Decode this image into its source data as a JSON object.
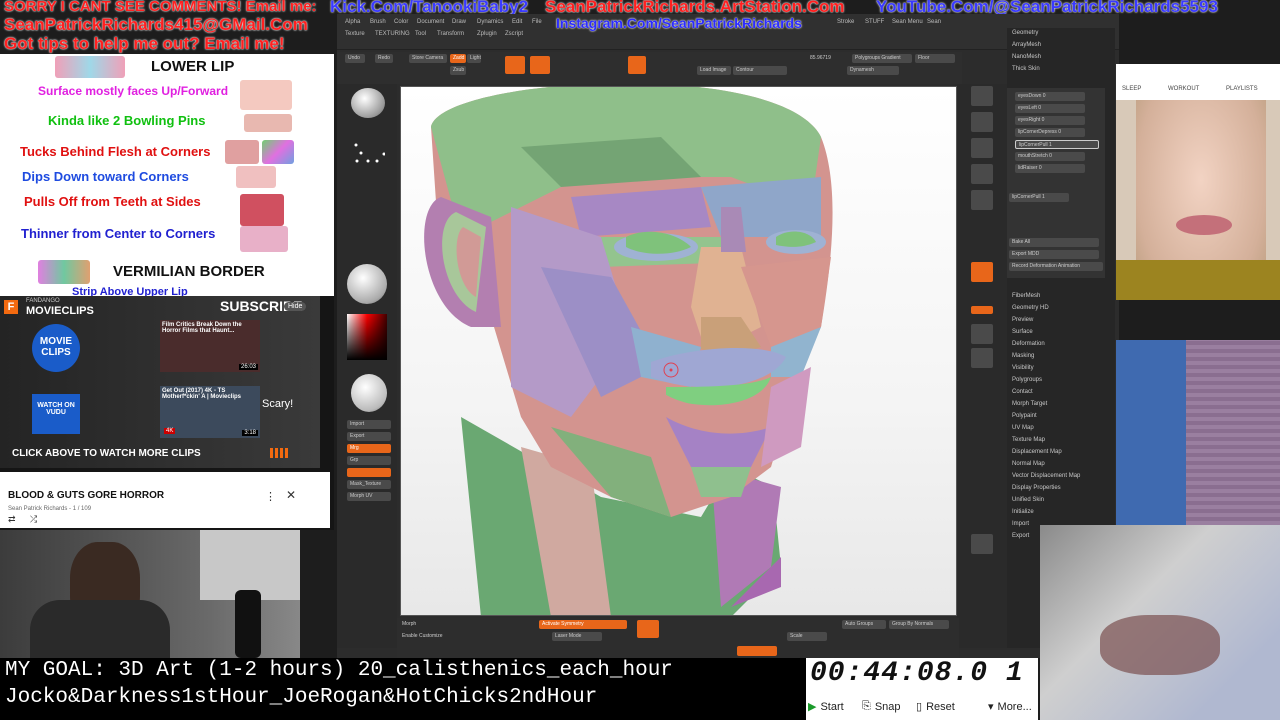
{
  "banner": {
    "line1": "SORRY I CANT SEE COMMENTS! Email me:",
    "line2": "Kick.Com/TanookiBaby2",
    "line3": "SeanPatrickRichards.ArtStation.Com",
    "line4": "YouTube.Com/@SeanPatrickRichards5593",
    "line5": "SeanPatrickRichards415@GMail.Com",
    "line6": "Got tips to help me out? Email me!",
    "line7": "Instagram.Com/SeanPatrickRichards"
  },
  "lip_sheet": {
    "title": "LOWER LIP",
    "rows": [
      {
        "text": "Surface mostly faces Up/Forward",
        "color": "#e020e0"
      },
      {
        "text": "Kinda like 2 Bowling Pins",
        "color": "#10c010"
      },
      {
        "text": "Tucks Behind Flesh at Corners",
        "color": "#e01010"
      },
      {
        "text": "Dips Down toward Corners",
        "color": "#1e4be0"
      },
      {
        "text": "Pulls Off from Teeth at Sides",
        "color": "#e01010"
      },
      {
        "text": "Thinner from Center to Corners",
        "color": "#2020d0"
      }
    ],
    "footer_title": "VERMILIAN BORDER",
    "footer_sub": "Strip Above Upper Lip"
  },
  "youtube": {
    "channel": "MOVIECLIPS",
    "channel_tag": "FANDANGO",
    "subscribe": "SUBSCRIBE",
    "hide": "Hide",
    "logo_text": "MOVIE CLIPS",
    "vudu_text": "WATCH ON VUDU",
    "card1_title": "Film Critics Break Down the Horror Films that Haunt...",
    "card1_time": "26:03",
    "card2_title": "Get Out (2017) 4K - TS Motherf*ckin' A | Movieclips",
    "card2_time": "3:18",
    "card2_tag": "4K",
    "scary": "Scary!",
    "click_above": "CLICK ABOVE TO WATCH MORE CLIPS",
    "playlist_title": "BLOOD & GUTS GORE HORROR",
    "playlist_sub": "Sean Patrick Richards - 1 / 109"
  },
  "zbrush": {
    "menu": [
      "Alpha",
      "Brush",
      "Color",
      "Document",
      "Draw",
      "Dynamics",
      "Edit",
      "File",
      "Layer",
      "Light",
      "Macro",
      "Marker",
      "Material",
      "Movie",
      "Picker",
      "Preferences",
      "Render",
      "Stencil",
      "Stroke",
      "STUFF",
      "Sean Menu",
      "Sean"
    ],
    "menu2": [
      "Texture",
      "TEXTURING",
      "Tool",
      "Transform",
      "Zplugin",
      "Zscript",
      "Help"
    ],
    "tool_buttons": [
      "Undo",
      "Redo",
      "Store Camera",
      "Zadd",
      "Zsub",
      "Lights",
      "Load Image",
      "Save MT",
      "Dynamesh",
      "Activate Symmetry",
      "Polygroups Gradient",
      "Contour",
      "Sculpt",
      "Floor"
    ],
    "numbers": [
      "85.96719",
      "0",
      "100",
      "0"
    ],
    "palette_items": [
      "Geometry",
      "ArrayMesh",
      "NanoMesh",
      "Thick Skin",
      "FiberMesh",
      "Geometry HD",
      "Preview",
      "Surface",
      "Deformation",
      "Masking",
      "Visibility",
      "Polygroups",
      "Contact",
      "Morph Target",
      "Polypaint",
      "UV Map",
      "Texture Map",
      "Displacement Map",
      "Normal Map",
      "Vector Displacement Map",
      "Display Properties",
      "Unified Skin",
      "Initialize",
      "Import",
      "Export"
    ],
    "sliders": [
      "eyesDown 0",
      "eyesLeft 0",
      "eyesRight 0",
      "lipCornerDepress 0",
      "lipCornerPull 1",
      "mouthStretch 0",
      "lidRaiser 0",
      "lipCornerPull 1"
    ],
    "palette_btns": [
      "Bake All",
      "Export MDD",
      "Record Deformation Animation"
    ],
    "bottom_labels": [
      "Morph",
      "Enable Customize",
      "Activate Symmetry",
      "Auto Groups",
      "Laser Mode",
      "Group By Normals",
      "Scale",
      "Move",
      "Rotate",
      "Crease",
      "Edit",
      "Draw"
    ],
    "left_labels": [
      "Color",
      "Material",
      "Alpha",
      "Texture",
      "Mask",
      "Import",
      "Export",
      "Mrg",
      "Grp",
      "Mask_Texture",
      "Morph UV"
    ]
  },
  "right_browser": [
    "SLEEP",
    "WORKOUT",
    "PLAYLISTS"
  ],
  "goal": {
    "line1": "MY GOAL: 3D Art (1-2 hours) 20_calisthenics_each_hour",
    "line2": "Jocko&Darkness1stHour_JoeRogan&HotChicks2ndHour"
  },
  "timer": {
    "value": "00:44:08.0 1",
    "start": "Start",
    "snap": "Snap",
    "reset": "Reset",
    "more": "More..."
  }
}
